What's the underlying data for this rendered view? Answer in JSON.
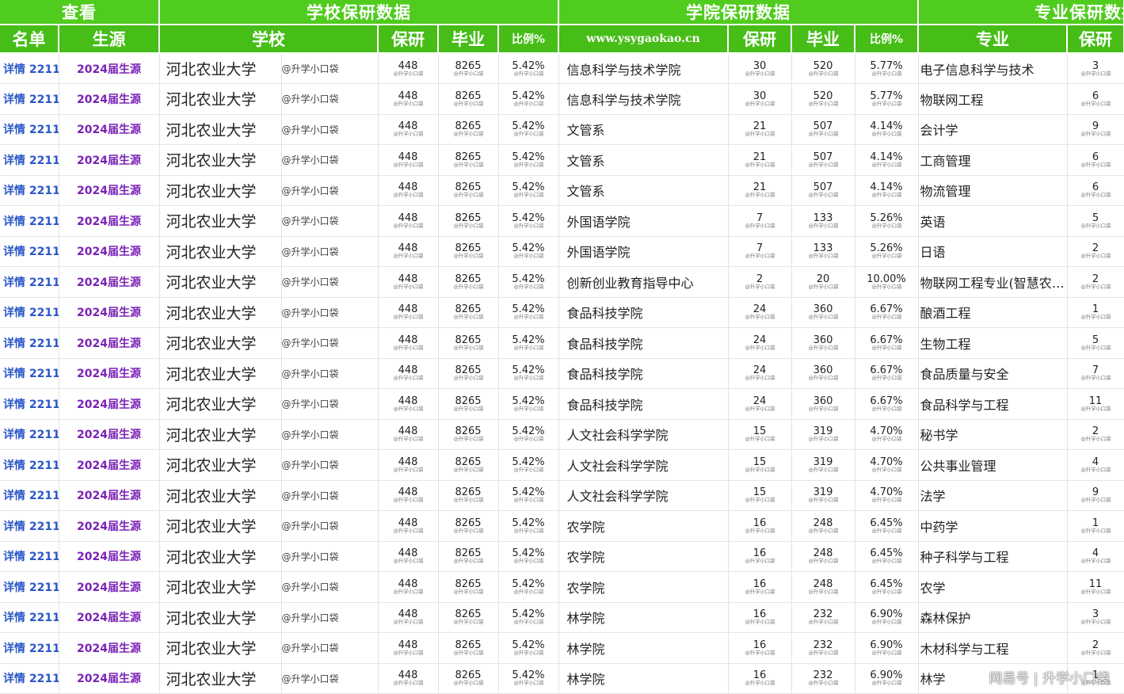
{
  "header": {
    "groups": [
      "查看",
      "学校保研数据",
      "学院保研数据",
      "专业保研数据"
    ],
    "columns": [
      "名单",
      "生源",
      "学校",
      "保研",
      "毕业",
      "比例%",
      "www.ysygaokao.cn",
      "保研",
      "毕业",
      "比例%",
      "专业",
      "保研"
    ]
  },
  "common": {
    "detail": "详情 2211",
    "source": "2024届生源",
    "school": "河北农业大学",
    "watermark": "@升学小口袋",
    "school_bao": "448",
    "school_bi": "8265",
    "school_ratio": "5.42%"
  },
  "rows": [
    {
      "college": "信息科学与技术学院",
      "cb": "30",
      "cg": "520",
      "cr": "5.77%",
      "major": "电子信息科学与技术",
      "mb": "3"
    },
    {
      "college": "信息科学与技术学院",
      "cb": "30",
      "cg": "520",
      "cr": "5.77%",
      "major": "物联网工程",
      "mb": "6"
    },
    {
      "college": "文管系",
      "cb": "21",
      "cg": "507",
      "cr": "4.14%",
      "major": "会计学",
      "mb": "9"
    },
    {
      "college": "文管系",
      "cb": "21",
      "cg": "507",
      "cr": "4.14%",
      "major": "工商管理",
      "mb": "6"
    },
    {
      "college": "文管系",
      "cb": "21",
      "cg": "507",
      "cr": "4.14%",
      "major": "物流管理",
      "mb": "6"
    },
    {
      "college": "外国语学院",
      "cb": "7",
      "cg": "133",
      "cr": "5.26%",
      "major": "英语",
      "mb": "5"
    },
    {
      "college": "外国语学院",
      "cb": "7",
      "cg": "133",
      "cr": "5.26%",
      "major": "日语",
      "mb": "2"
    },
    {
      "college": "创新创业教育指导中心",
      "cb": "2",
      "cg": "20",
      "cr": "10.00%",
      "major": "物联网工程专业(智慧农…",
      "mb": "2"
    },
    {
      "college": "食品科技学院",
      "cb": "24",
      "cg": "360",
      "cr": "6.67%",
      "major": "酿酒工程",
      "mb": "1"
    },
    {
      "college": "食品科技学院",
      "cb": "24",
      "cg": "360",
      "cr": "6.67%",
      "major": "生物工程",
      "mb": "5"
    },
    {
      "college": "食品科技学院",
      "cb": "24",
      "cg": "360",
      "cr": "6.67%",
      "major": "食品质量与安全",
      "mb": "7"
    },
    {
      "college": "食品科技学院",
      "cb": "24",
      "cg": "360",
      "cr": "6.67%",
      "major": "食品科学与工程",
      "mb": "11"
    },
    {
      "college": "人文社会科学学院",
      "cb": "15",
      "cg": "319",
      "cr": "4.70%",
      "major": "秘书学",
      "mb": "2"
    },
    {
      "college": "人文社会科学学院",
      "cb": "15",
      "cg": "319",
      "cr": "4.70%",
      "major": "公共事业管理",
      "mb": "4"
    },
    {
      "college": "人文社会科学学院",
      "cb": "15",
      "cg": "319",
      "cr": "4.70%",
      "major": "法学",
      "mb": "9"
    },
    {
      "college": "农学院",
      "cb": "16",
      "cg": "248",
      "cr": "6.45%",
      "major": "中药学",
      "mb": "1"
    },
    {
      "college": "农学院",
      "cb": "16",
      "cg": "248",
      "cr": "6.45%",
      "major": "种子科学与工程",
      "mb": "4"
    },
    {
      "college": "农学院",
      "cb": "16",
      "cg": "248",
      "cr": "6.45%",
      "major": "农学",
      "mb": "11"
    },
    {
      "college": "林学院",
      "cb": "16",
      "cg": "232",
      "cr": "6.90%",
      "major": "森林保护",
      "mb": "3"
    },
    {
      "college": "林学院",
      "cb": "16",
      "cg": "232",
      "cr": "6.90%",
      "major": "木材科学与工程",
      "mb": "2"
    },
    {
      "college": "林学院",
      "cb": "16",
      "cg": "232",
      "cr": "6.90%",
      "major": "林学",
      "mb": "1"
    }
  ],
  "footer_watermark": "网易号 | 升学小口袋"
}
